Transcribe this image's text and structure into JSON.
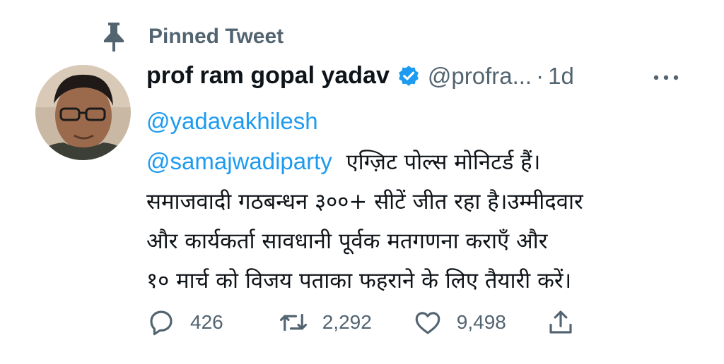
{
  "pinned": {
    "label": "Pinned Tweet",
    "icon": "pin-icon"
  },
  "author": {
    "name": "prof ram gopal yadav",
    "handle": "@profra...",
    "separator": "·",
    "time": "1d",
    "verified_icon": "verified-badge-icon",
    "avatar": "profile-photo"
  },
  "tweet": {
    "mention1": "@yadavakhilesh",
    "mention2": "@samajwadiparty",
    "line2_text": "एग्ज़िट पोल्स मोनिटर्ड हैं।",
    "line3": "समाजवादी गठबन्धन ३००+ सीटें जीत रहा है।उम्मीदवार",
    "line4": "और कार्यकर्ता  सावधानी पूर्वक मतगणना कराएँ और",
    "line5": "१० मार्च को विजय पताका फहराने के लिए तैयारी करें।"
  },
  "actions": {
    "reply_count": "426",
    "retweet_count": "2,292",
    "like_count": "9,498",
    "icons": [
      "reply-icon",
      "retweet-icon",
      "like-icon",
      "share-icon"
    ]
  },
  "colors": {
    "link": "#1d9bf0",
    "secondary": "#536471",
    "text": "#0f1419"
  }
}
